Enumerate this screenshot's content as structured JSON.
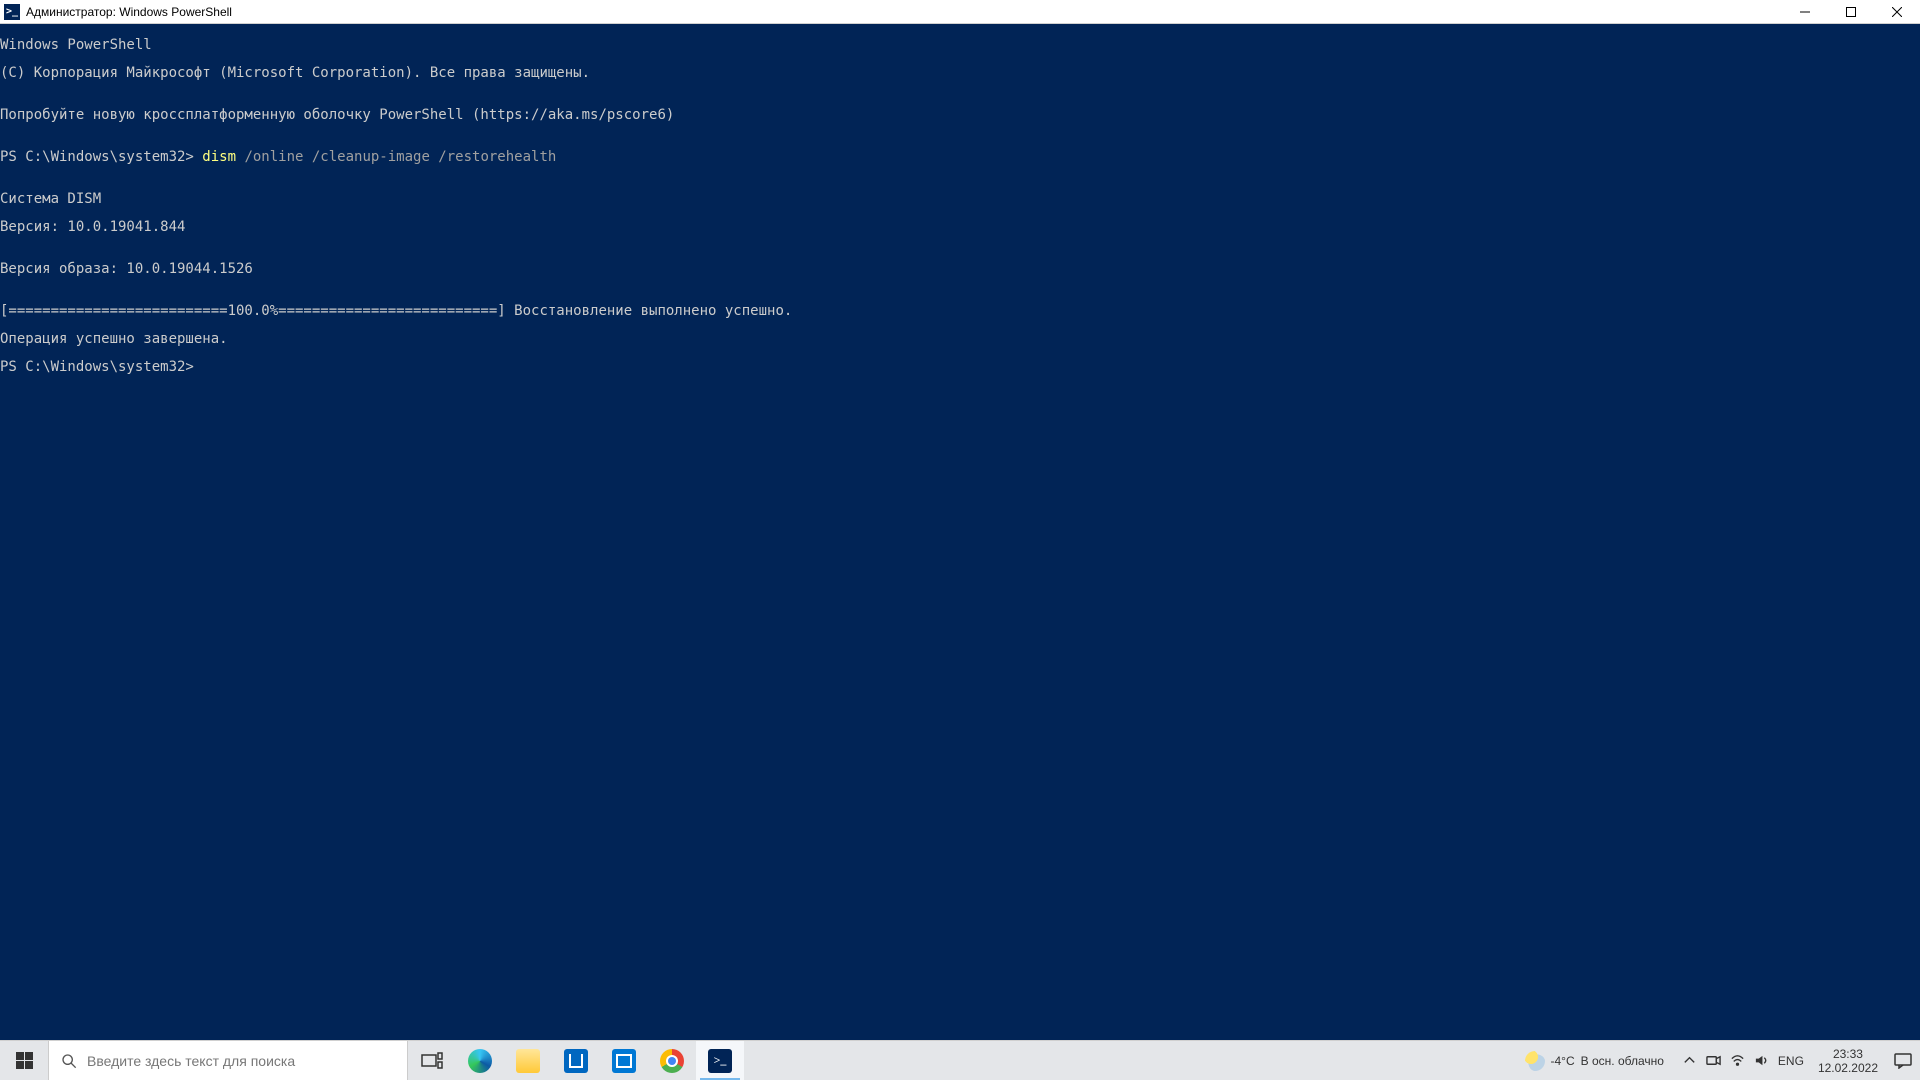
{
  "window": {
    "title": "Администратор: Windows PowerShell"
  },
  "terminal": {
    "line1": "Windows PowerShell",
    "line2": "(C) Корпорация Майкрософт (Microsoft Corporation). Все права защищены.",
    "line3": "",
    "line4": "Попробуйте новую кроссплатформенную оболочку PowerShell (https://aka.ms/pscore6)",
    "line5": "",
    "prompt1_prefix": "PS C:\\Windows\\system32> ",
    "cmd_word": "dism",
    "cmd_rest": " /online /cleanup-image /restorehealth",
    "line7": "",
    "line8": "Cистема DISM",
    "line9": "Версия: 10.0.19041.844",
    "line10": "",
    "line11": "Версия образа: 10.0.19044.1526",
    "line12": "",
    "line13": "[==========================100.0%==========================] Восстановление выполнено успешно.",
    "line14": "Операция успешно завершена.",
    "prompt2": "PS C:\\Windows\\system32> "
  },
  "taskbar": {
    "search_placeholder": "Введите здесь текст для поиска",
    "weather_temp": "-4°C",
    "weather_cond": "В осн. облачно",
    "lang": "ENG",
    "time": "23:33",
    "date": "12.02.2022"
  }
}
